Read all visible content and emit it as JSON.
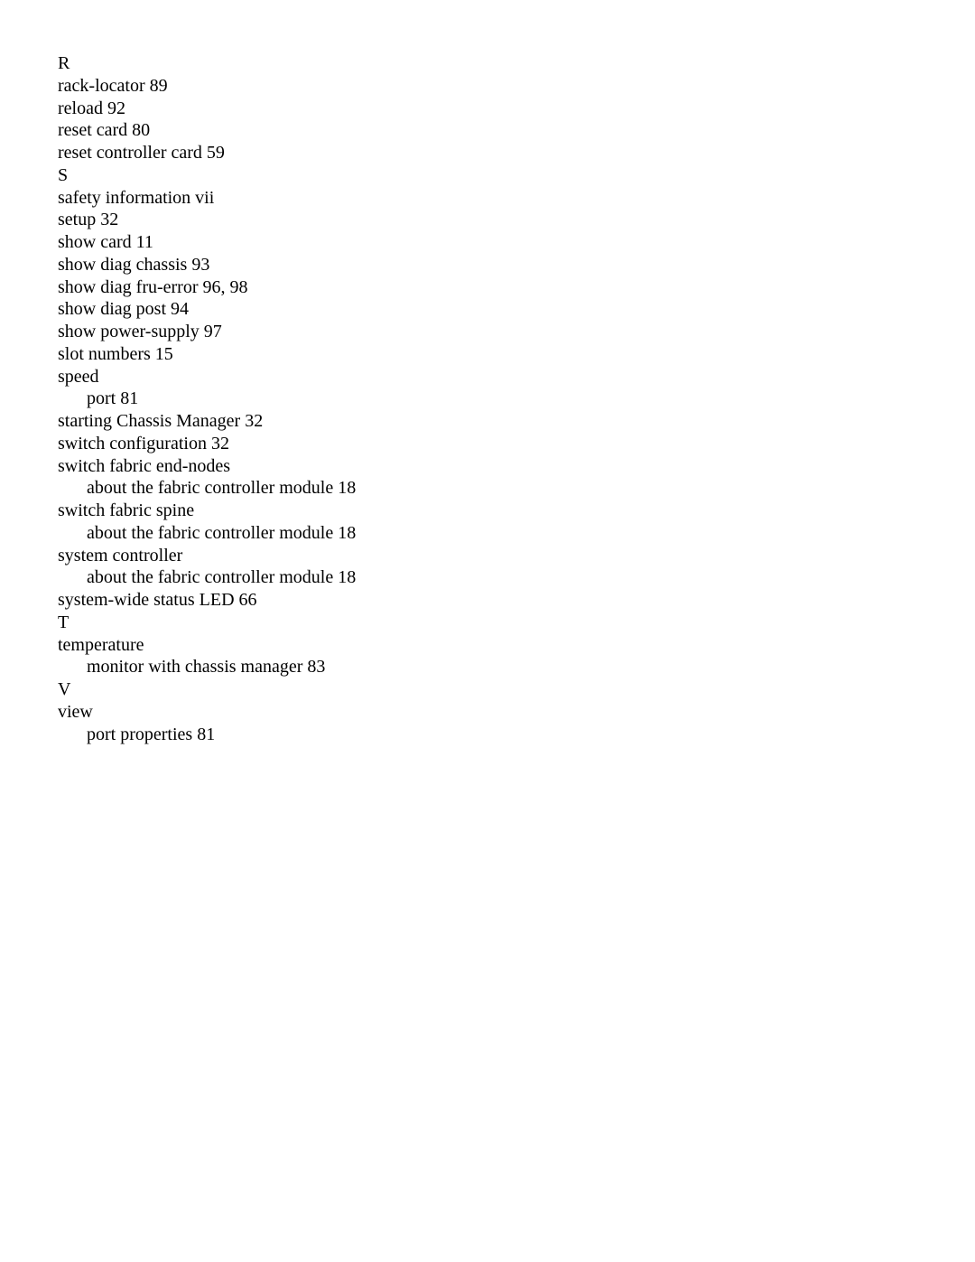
{
  "document": {
    "type": "index",
    "entries": [
      {
        "kind": "letter",
        "text": "R"
      },
      {
        "kind": "term",
        "text": "rack-locator 89"
      },
      {
        "kind": "term",
        "text": "reload 92"
      },
      {
        "kind": "term",
        "text": "reset card 80"
      },
      {
        "kind": "term",
        "text": "reset controller card 59"
      },
      {
        "kind": "letter",
        "text": "S"
      },
      {
        "kind": "term",
        "text": "safety information vii"
      },
      {
        "kind": "term",
        "text": "setup 32"
      },
      {
        "kind": "term",
        "text": "show card 11"
      },
      {
        "kind": "term",
        "text": "show diag chassis 93"
      },
      {
        "kind": "term",
        "text": "show diag fru-error 96, 98"
      },
      {
        "kind": "term",
        "text": "show diag post 94"
      },
      {
        "kind": "term",
        "text": "show power-supply 97"
      },
      {
        "kind": "term",
        "text": "slot numbers 15"
      },
      {
        "kind": "term",
        "text": "speed"
      },
      {
        "kind": "subterm",
        "text": "port 81"
      },
      {
        "kind": "term",
        "text": "starting Chassis Manager 32"
      },
      {
        "kind": "term",
        "text": "switch configuration 32"
      },
      {
        "kind": "term",
        "text": "switch fabric end-nodes"
      },
      {
        "kind": "subterm",
        "text": "about the fabric controller module 18"
      },
      {
        "kind": "term",
        "text": "switch fabric spine"
      },
      {
        "kind": "subterm",
        "text": "about the fabric controller module 18"
      },
      {
        "kind": "term",
        "text": "system controller"
      },
      {
        "kind": "subterm",
        "text": "about the fabric controller module 18"
      },
      {
        "kind": "term",
        "text": "system-wide status LED 66"
      },
      {
        "kind": "letter",
        "text": "T"
      },
      {
        "kind": "term",
        "text": "temperature"
      },
      {
        "kind": "subterm",
        "text": "monitor with chassis manager 83"
      },
      {
        "kind": "letter",
        "text": "V"
      },
      {
        "kind": "term",
        "text": "view"
      },
      {
        "kind": "subterm",
        "text": "port properties 81"
      }
    ]
  }
}
